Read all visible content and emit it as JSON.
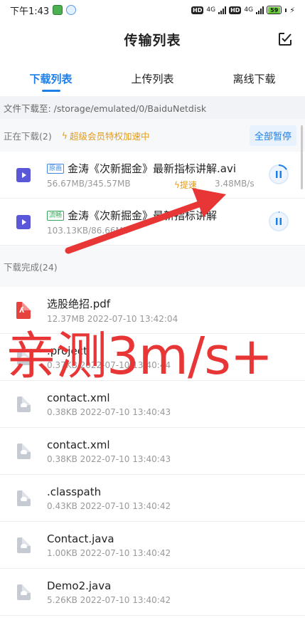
{
  "status_bar": {
    "time": "下午1:43",
    "network": "4G",
    "hd": "HD",
    "battery": "59"
  },
  "header": {
    "title": "传输列表",
    "edit_icon": "checkbox-edit-icon"
  },
  "tabs": [
    {
      "label": "下载列表",
      "active": true
    },
    {
      "label": "上传列表",
      "active": false
    },
    {
      "label": "离线下载",
      "active": false
    }
  ],
  "download_path": "文件下载至: /storage/emulated/0/BaiduNetdisk",
  "downloading": {
    "header": "正在下载(2)",
    "vip_text": "超级会员特权加速中",
    "pause_all": "全部暂停",
    "items": [
      {
        "tag": "原画",
        "name": "金涛《次新掘金》最新指标讲解.avi",
        "progress": "56.67MB/345.57MB",
        "speedup_label": "提速",
        "speed": "3.48MB/s",
        "progress_fraction": 0.16,
        "icon": "video-file-icon"
      },
      {
        "tag": "流畅",
        "name": "金涛《次新掘金》最新指标讲解",
        "progress": "103.13KB/86.66MB",
        "progress_fraction": 0.01,
        "icon": "video-file-icon"
      }
    ]
  },
  "completed": {
    "header": "下载完成(24)",
    "items": [
      {
        "name": "选股绝招.pdf",
        "meta": "12.37MB 2022-07-10 13:42:04",
        "icon": "pdf-file-icon"
      },
      {
        "name": ".project",
        "meta": "0.37KB 2022-07-10 13:40:44",
        "icon": "generic-file-icon"
      },
      {
        "name": "contact.xml",
        "meta": "0.38KB 2022-07-10 13:40:43",
        "icon": "generic-file-icon"
      },
      {
        "name": "contact.xml",
        "meta": "0.38KB 2022-07-10 13:40:43",
        "icon": "generic-file-icon"
      },
      {
        "name": ".classpath",
        "meta": "0.43KB 2022-07-10 13:40:42",
        "icon": "generic-file-icon"
      },
      {
        "name": "Contact.java",
        "meta": "1.00KB 2022-07-10 13:40:42",
        "icon": "generic-file-icon"
      },
      {
        "name": "Demo2.java",
        "meta": "5.26KB 2022-07-10 13:40:42",
        "icon": "generic-file-icon"
      }
    ]
  },
  "overlay": {
    "text": "亲测3m/s+",
    "color": "#e83535"
  },
  "colors": {
    "accent": "#1f7fe8",
    "vip": "#e39b1c",
    "video_icon": "#5b57d9",
    "pdf_icon": "#e6433f"
  }
}
